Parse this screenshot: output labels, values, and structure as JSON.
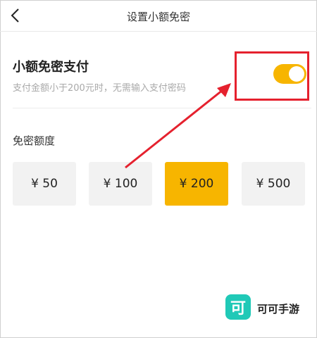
{
  "header": {
    "title": "设置小额免密"
  },
  "payment": {
    "title": "小额免密支付",
    "description": "支付金额小于200元时，无需输入支付密码",
    "enabled": true
  },
  "limit": {
    "label": "免密额度",
    "options": [
      "¥ 50",
      "¥ 100",
      "¥ 200",
      "¥ 500"
    ],
    "selected": "¥ 200"
  },
  "watermark": {
    "icon_char": "可",
    "text": "可可手游"
  },
  "colors": {
    "accent": "#f7b500",
    "highlight": "#e5212e",
    "logo": "#20c9b7"
  },
  "icons": {
    "back": "chevron-left-icon"
  }
}
